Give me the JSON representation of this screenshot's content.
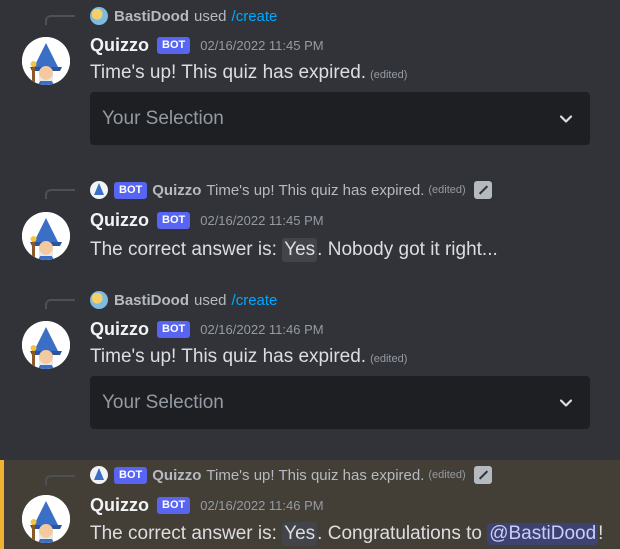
{
  "messages": [
    {
      "reply": {
        "type": "command",
        "user": "BastiDood",
        "used": "used",
        "command": "/create"
      },
      "author": "Quizzo",
      "badge": "BOT",
      "timestamp": "02/16/2022 11:45 PM",
      "content": "Time's up! This quiz has expired.",
      "edited": "(edited)",
      "select_placeholder": "Your Selection"
    },
    {
      "reply": {
        "type": "message",
        "author": "Quizzo",
        "badge": "BOT",
        "text": "Time's up! This quiz has expired.",
        "edited": "(edited)"
      },
      "author": "Quizzo",
      "badge": "BOT",
      "timestamp": "02/16/2022 11:45 PM",
      "content_prefix": "The correct answer is: ",
      "answer": "Yes",
      "content_suffix": ". Nobody got it right..."
    },
    {
      "reply": {
        "type": "command",
        "user": "BastiDood",
        "used": "used",
        "command": "/create"
      },
      "author": "Quizzo",
      "badge": "BOT",
      "timestamp": "02/16/2022 11:46 PM",
      "content": "Time's up! This quiz has expired.",
      "edited": "(edited)",
      "select_placeholder": "Your Selection"
    },
    {
      "reply": {
        "type": "message",
        "author": "Quizzo",
        "badge": "BOT",
        "text": "Time's up! This quiz has expired.",
        "edited": "(edited)"
      },
      "author": "Quizzo",
      "badge": "BOT",
      "timestamp": "02/16/2022 11:46 PM",
      "content_prefix": "The correct answer is: ",
      "answer": "Yes",
      "content_mid": ". Congratulations to ",
      "mention": "@BastiDood",
      "content_suffix": "!"
    }
  ],
  "colors": {
    "background": "#313338",
    "highlight_background": "#443f36",
    "highlight_border": "#f0b232",
    "bot_badge": "#5865f2",
    "command_link": "#00a8fc",
    "select_background": "#1e1f22"
  }
}
